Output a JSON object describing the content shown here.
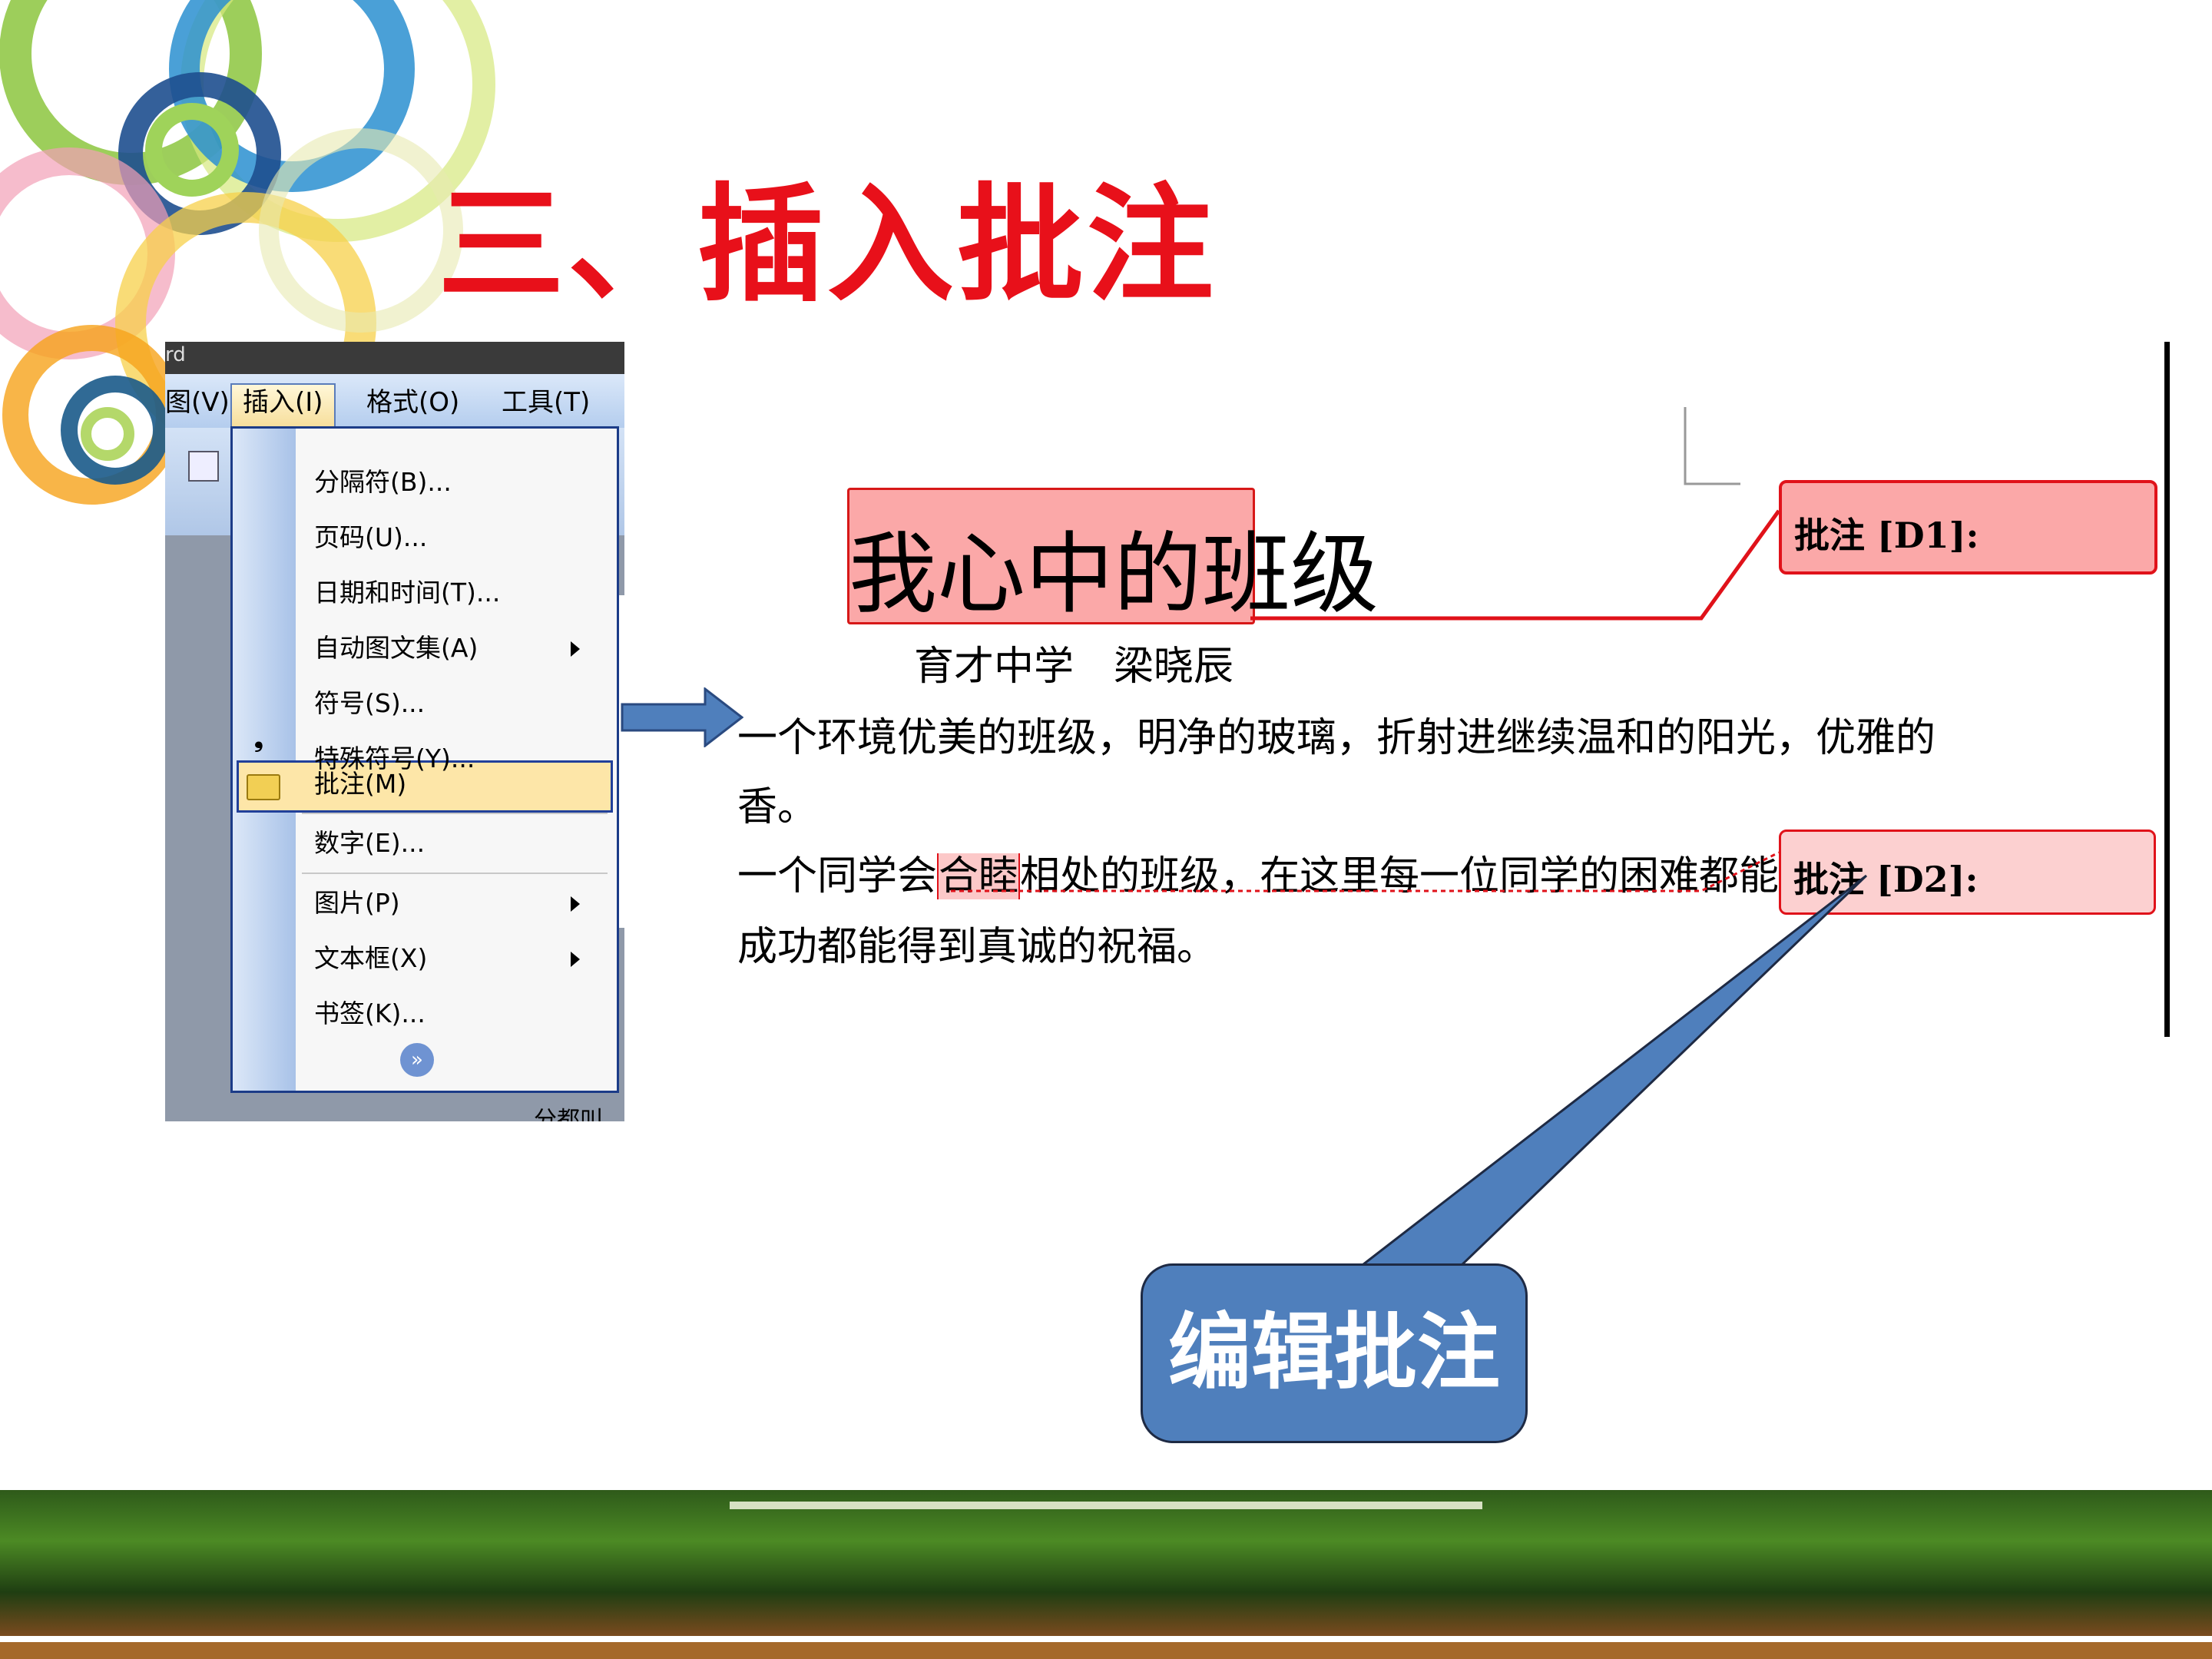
{
  "slide": {
    "title": "三、插入批注"
  },
  "menu": {
    "window_title_fragment": "rd",
    "menubar": [
      "图(V)",
      "插入(I)",
      "格式(O)",
      "工具(T)"
    ],
    "items": [
      {
        "label": "分隔符(B)..."
      },
      {
        "label": "页码(U)..."
      },
      {
        "label": "日期和时间(T)..."
      },
      {
        "label": "自动图文集(A)"
      },
      {
        "label": "符号(S)..."
      },
      {
        "label": "特殊符号(Y)..."
      },
      {
        "label": "批注(M)"
      },
      {
        "label": "数字(E)..."
      },
      {
        "label": "图片(P)"
      },
      {
        "label": "文本框(X)"
      },
      {
        "label": "书签(K)..."
      }
    ],
    "below_text": "分都叫"
  },
  "document": {
    "title": "我心中的班级",
    "byline": "育才中学　梁晓辰",
    "line1": "一个环境优美的班级，明净的玻璃，折射进继续温和的阳光，优雅的",
    "line2": "香。",
    "line3_pre": "一个同学会",
    "line3_highlight": "合睦",
    "line3_post": "相处的班级，在这里每一位同学的困难都能得到热情",
    "line4": "成功都能得到真诚的祝福。"
  },
  "comments": [
    {
      "label": "批注 [D1]:"
    },
    {
      "label": "批注 [D2]:"
    }
  ],
  "callout": {
    "text": "编辑批注"
  },
  "colors": {
    "title_red": "#e8101a",
    "callout_blue": "#4f7fbc",
    "comment_pink": "#fba8a8"
  }
}
